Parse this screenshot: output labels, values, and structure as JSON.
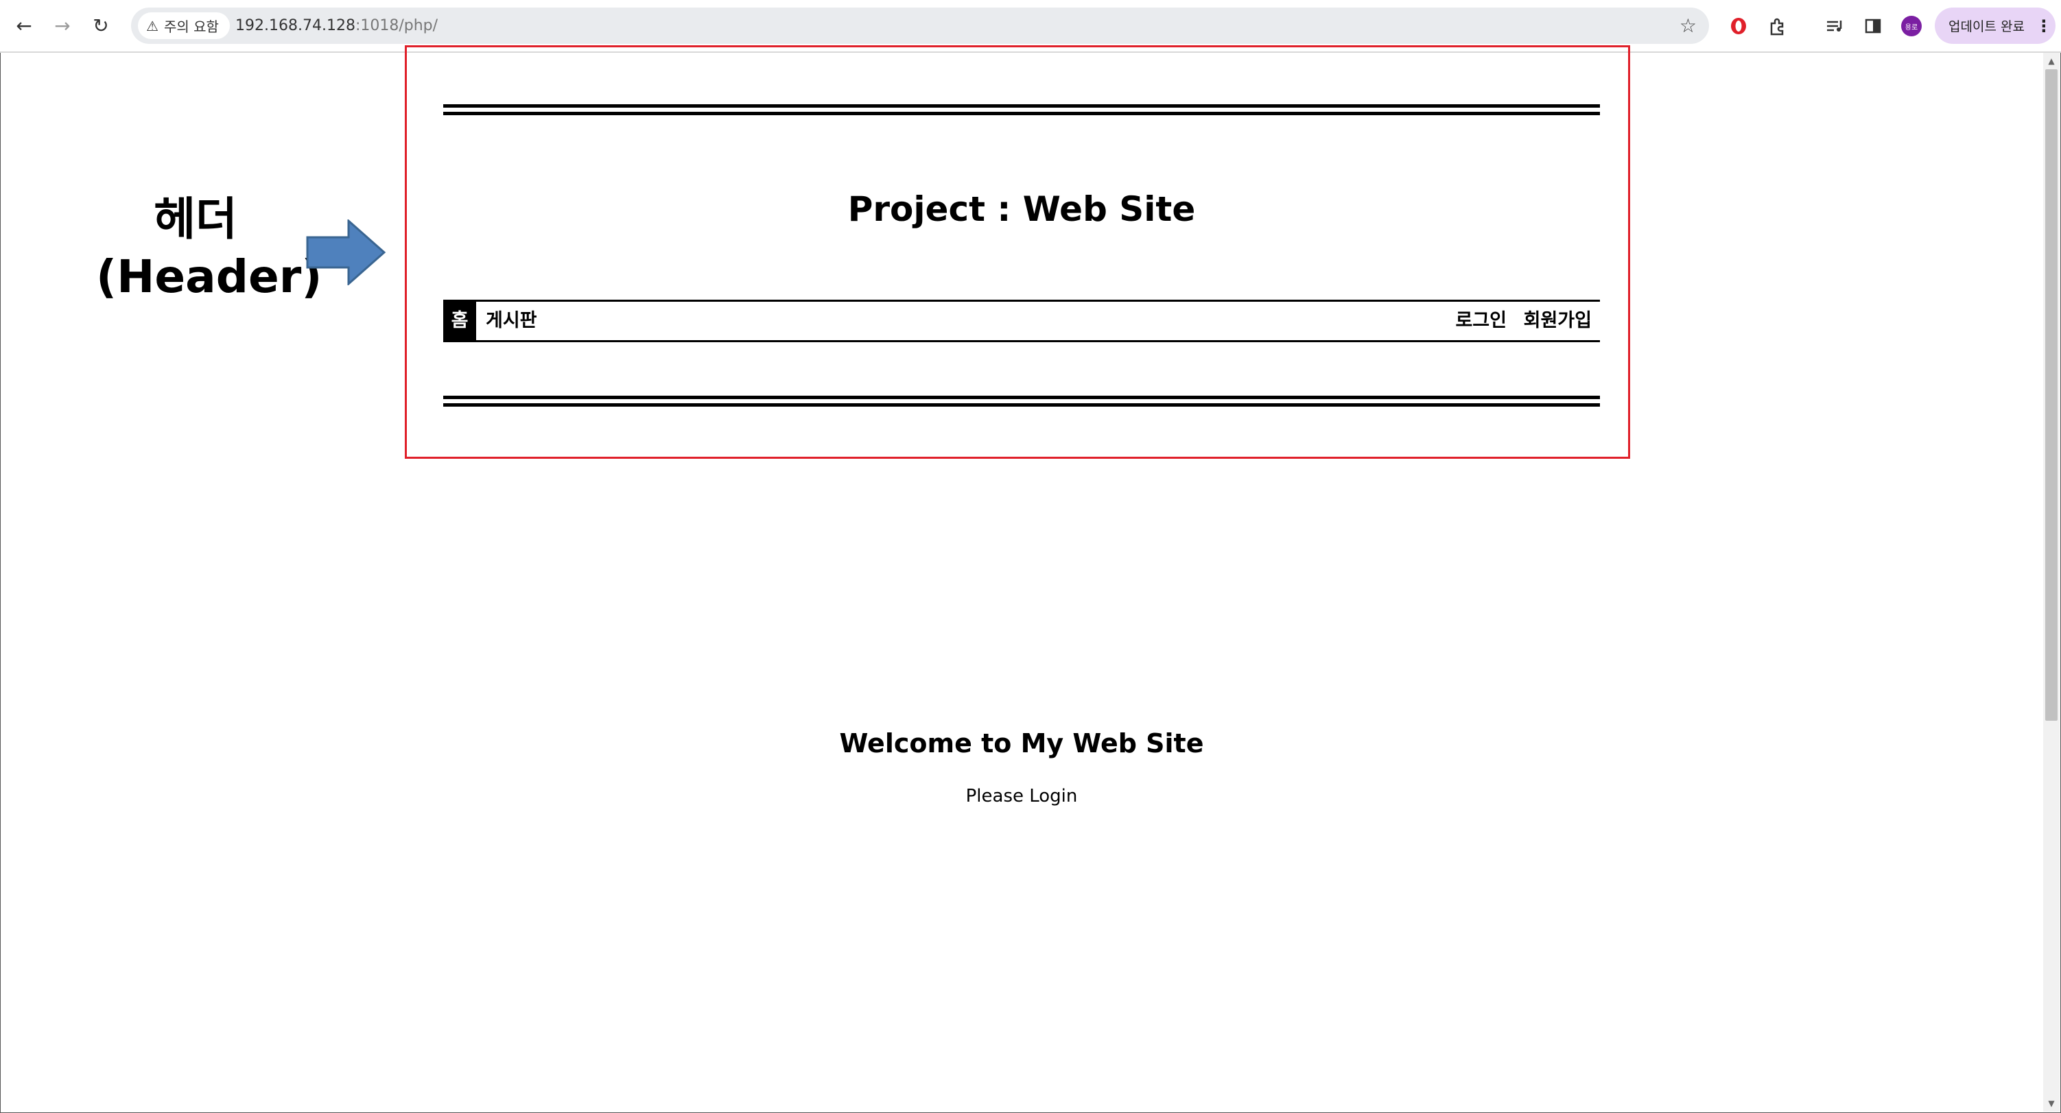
{
  "browser": {
    "security_label": "주의 요함",
    "url_host": "192.168.74.128",
    "url_rest": ":1018/php/",
    "update_button_label": "업데이트 완료",
    "icons": [
      "back-icon",
      "forward-icon",
      "reload-icon",
      "warning-icon",
      "star-icon",
      "opera-icon",
      "extensions-icon",
      "media-icon",
      "side-panel-icon",
      "avatar-icon",
      "kebab-menu-icon"
    ],
    "avatar_label": "용로"
  },
  "annotation": {
    "line1": "헤더",
    "line2": "(Header)",
    "box_color": "#e0202a",
    "arrow_color": "#4f81bd"
  },
  "site": {
    "title": "Project : Web Site",
    "menu": {
      "home": "홈",
      "board": "게시판",
      "login": "로그인",
      "join": "회원가입"
    },
    "welcome": "Welcome to My Web Site",
    "prompt": "Please Login"
  }
}
